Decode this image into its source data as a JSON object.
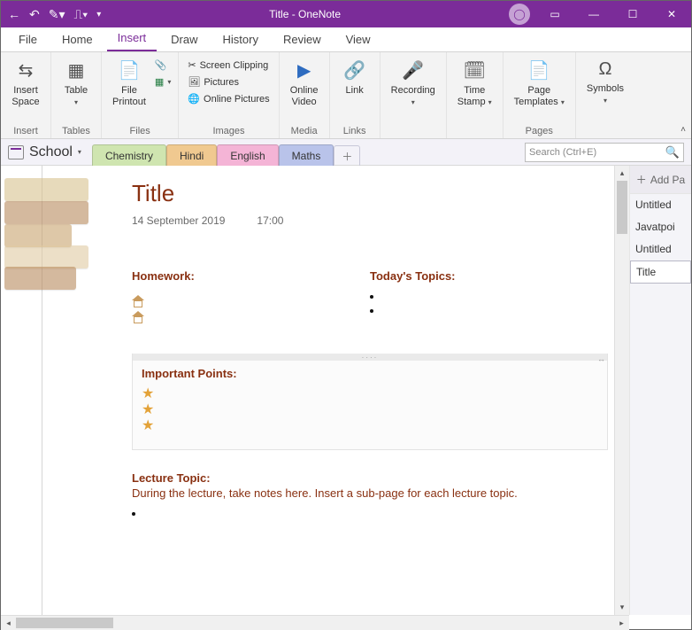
{
  "app": {
    "title": "Title  -  OneNote"
  },
  "menu": {
    "file": "File",
    "home": "Home",
    "insert": "Insert",
    "draw": "Draw",
    "history": "History",
    "review": "Review",
    "view": "View"
  },
  "ribbon": {
    "insert_space": "Insert\nSpace",
    "insert_grp": "Insert",
    "table": "Table",
    "tables_grp": "Tables",
    "file_printout": "File\nPrintout",
    "files_grp": "Files",
    "screen_clip": "Screen Clipping",
    "pictures": "Pictures",
    "online_pics": "Online Pictures",
    "images_grp": "Images",
    "online_video": "Online\nVideo",
    "media_grp": "Media",
    "link": "Link",
    "links_grp": "Links",
    "recording": "Recording",
    "timestamp": "Time\nStamp",
    "page_templates": "Page\nTemplates",
    "pages_grp": "Pages",
    "symbols": "Symbols"
  },
  "notebook": {
    "name": "School"
  },
  "sections": {
    "chemistry": {
      "label": "Chemistry",
      "bg": "#cfe5b0"
    },
    "hindi": {
      "label": "Hindi",
      "bg": "#f0c990"
    },
    "english": {
      "label": "English",
      "bg": "#f4b4d6"
    },
    "maths": {
      "label": "Maths",
      "bg": "#b9c3ea"
    }
  },
  "search": {
    "placeholder": "Search (Ctrl+E)"
  },
  "pagelist": {
    "add": "Add Pa",
    "items": [
      "Untitled",
      "Javatpoi",
      "Untitled",
      "Title"
    ]
  },
  "note": {
    "title": "Title",
    "date": "14 September 2019",
    "time": "17:00",
    "homework": "Homework:",
    "todays": "Today's Topics:",
    "important": "Important Points:",
    "lecture_hdr": "Lecture Topic:",
    "lecture_txt": "During the lecture, take notes here.  Insert a sub-page for each lecture topic."
  }
}
